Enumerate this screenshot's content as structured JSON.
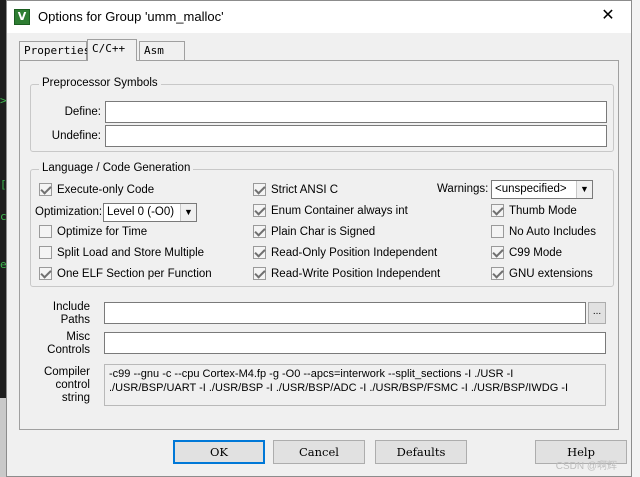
{
  "window": {
    "title": "Options for Group 'umm_malloc'",
    "close_glyph": "✕",
    "icon_glyph": "V"
  },
  "tabs": [
    {
      "label": "Properties",
      "active": false
    },
    {
      "label": "C/C++",
      "active": true
    },
    {
      "label": "Asm",
      "active": false
    }
  ],
  "preprocessor": {
    "group_label": "Preprocessor Symbols",
    "define_label": "Define:",
    "define_value": "",
    "undefine_label": "Undefine:",
    "undefine_value": ""
  },
  "language": {
    "group_label": "Language / Code Generation",
    "execute_only": {
      "label": "Execute-only Code",
      "checked": true
    },
    "optimization_label": "Optimization:",
    "optimization_value": "Level 0 (-O0)",
    "optimize_time": {
      "label": "Optimize for Time",
      "checked": false
    },
    "split_load": {
      "label": "Split Load and Store Multiple",
      "checked": false
    },
    "one_elf": {
      "label": "One ELF Section per Function",
      "checked": true
    },
    "strict_ansi": {
      "label": "Strict ANSI C",
      "checked": true
    },
    "enum_container": {
      "label": "Enum Container always int",
      "checked": true
    },
    "plain_char": {
      "label": "Plain Char is Signed",
      "checked": true
    },
    "ropi": {
      "label": "Read-Only Position Independent",
      "checked": true
    },
    "rwpi": {
      "label": "Read-Write Position Independent",
      "checked": true
    },
    "warnings_label": "Warnings:",
    "warnings_value": "<unspecified>",
    "thumb_mode": {
      "label": "Thumb Mode",
      "checked": true
    },
    "no_auto_includes": {
      "label": "No Auto Includes",
      "checked": false
    },
    "c99_mode": {
      "label": "C99 Mode",
      "checked": true
    },
    "gnu_extensions": {
      "label": "GNU extensions",
      "checked": true
    }
  },
  "include_paths": {
    "label_line1": "Include",
    "label_line2": "Paths",
    "value": "",
    "browse_label": "..."
  },
  "misc_controls": {
    "label_line1": "Misc",
    "label_line2": "Controls",
    "value": ""
  },
  "compiler_control": {
    "label_line1": "Compiler",
    "label_line2": "control",
    "label_line3": "string",
    "value": "-c99 --gnu -c --cpu Cortex-M4.fp -g -O0 --apcs=interwork --split_sections -I ./USR -I ./USR/BSP/UART -I ./USR/BSP -I ./USR/BSP/ADC -I ./USR/BSP/FSMC -I ./USR/BSP/IWDG -I"
  },
  "buttons": {
    "ok": "OK",
    "cancel": "Cancel",
    "defaults": "Defaults",
    "help": "Help"
  },
  "watermark": "CSDN @啊辉"
}
